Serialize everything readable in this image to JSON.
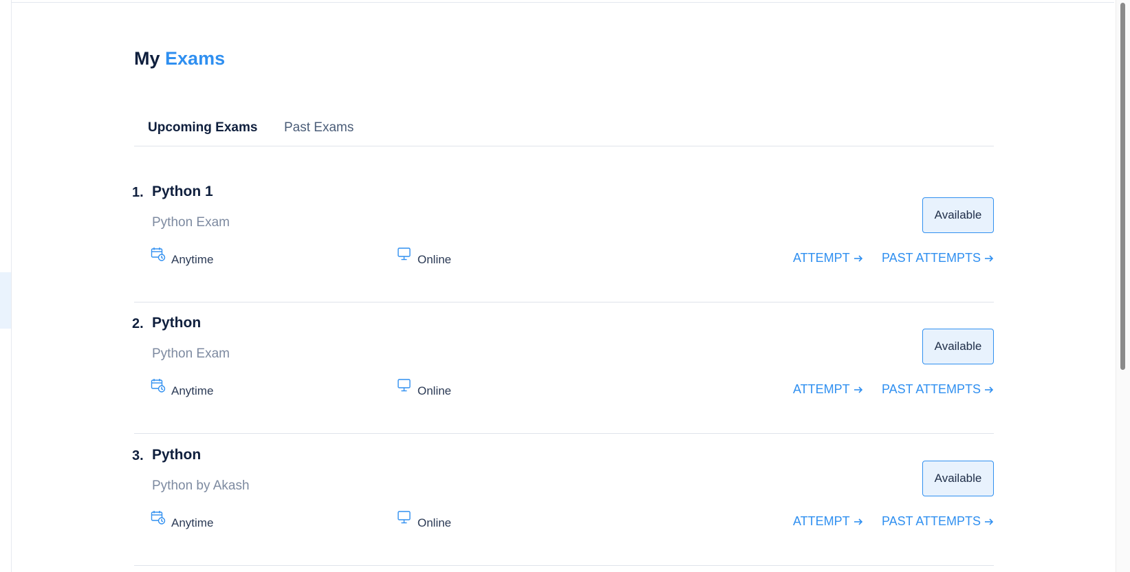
{
  "page": {
    "title_plain": "My",
    "title_accent": "Exams"
  },
  "tabs": [
    {
      "label": "Upcoming Exams",
      "active": true
    },
    {
      "label": "Past Exams",
      "active": false
    }
  ],
  "exams": [
    {
      "number": "1.",
      "name": "Python 1",
      "description": "Python Exam",
      "status": "Available",
      "schedule": "Anytime",
      "mode": "Online",
      "attempt_label": "ATTEMPT",
      "past_attempts_label": "PAST ATTEMPTS"
    },
    {
      "number": "2.",
      "name": "Python",
      "description": "Python Exam",
      "status": "Available",
      "schedule": "Anytime",
      "mode": "Online",
      "attempt_label": "ATTEMPT",
      "past_attempts_label": "PAST ATTEMPTS"
    },
    {
      "number": "3.",
      "name": "Python",
      "description": "Python by Akash",
      "status": "Available",
      "schedule": "Anytime",
      "mode": "Online",
      "attempt_label": "ATTEMPT",
      "past_attempts_label": "PAST ATTEMPTS"
    }
  ],
  "icons": {
    "schedule": "calendar-clock-icon",
    "mode": "monitor-icon",
    "action_arrow": "arrow-right-icon"
  },
  "colors": {
    "accent": "#2f8ff0",
    "heading": "#0f1f3d",
    "muted": "#7d8aa0",
    "badge_bg": "#e8f2fd"
  }
}
